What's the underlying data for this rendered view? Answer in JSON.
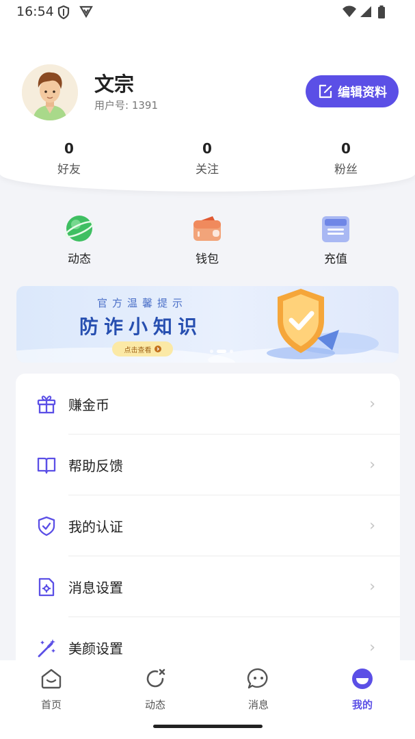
{
  "status_bar": {
    "time": "16:54"
  },
  "profile": {
    "name": "文宗",
    "user_id": "用户号: 1391",
    "edit_label": "编辑资料"
  },
  "stats": [
    {
      "num": "0",
      "label": "好友"
    },
    {
      "num": "0",
      "label": "关注"
    },
    {
      "num": "0",
      "label": "粉丝"
    }
  ],
  "quick": [
    {
      "label": "动态",
      "icon": "planet-icon"
    },
    {
      "label": "钱包",
      "icon": "wallet-icon"
    },
    {
      "label": "充值",
      "icon": "card-icon"
    }
  ],
  "banner": {
    "subtitle": "官方温馨提示",
    "title": "防诈小知识",
    "button": "点击查看"
  },
  "menu": [
    {
      "label": "赚金币",
      "icon": "gift-icon"
    },
    {
      "label": "帮助反馈",
      "icon": "book-icon"
    },
    {
      "label": "我的认证",
      "icon": "shield-check-icon"
    },
    {
      "label": "消息设置",
      "icon": "settings-doc-icon"
    },
    {
      "label": "美颜设置",
      "icon": "magic-wand-icon"
    }
  ],
  "tabs": [
    {
      "label": "首页",
      "icon": "home-icon"
    },
    {
      "label": "动态",
      "icon": "refresh-icon"
    },
    {
      "label": "消息",
      "icon": "chat-icon"
    },
    {
      "label": "我的",
      "icon": "profile-icon",
      "active": true
    }
  ],
  "colors": {
    "accent": "#5b4fe6",
    "background": "#f3f4f8"
  }
}
